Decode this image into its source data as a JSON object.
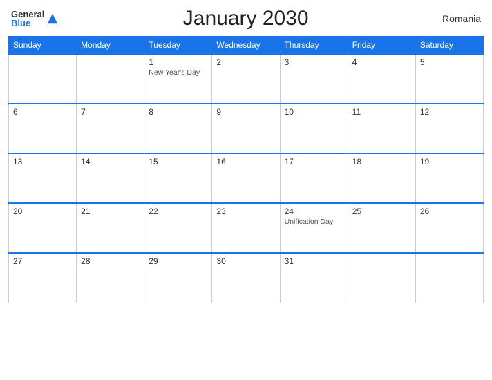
{
  "header": {
    "logo_general": "General",
    "logo_blue": "Blue",
    "title": "January 2030",
    "country": "Romania"
  },
  "days_of_week": [
    "Sunday",
    "Monday",
    "Tuesday",
    "Wednesday",
    "Thursday",
    "Friday",
    "Saturday"
  ],
  "weeks": [
    [
      {
        "day": "",
        "holiday": ""
      },
      {
        "day": "",
        "holiday": ""
      },
      {
        "day": "1",
        "holiday": "New Year's Day"
      },
      {
        "day": "2",
        "holiday": ""
      },
      {
        "day": "3",
        "holiday": ""
      },
      {
        "day": "4",
        "holiday": ""
      },
      {
        "day": "5",
        "holiday": ""
      }
    ],
    [
      {
        "day": "6",
        "holiday": ""
      },
      {
        "day": "7",
        "holiday": ""
      },
      {
        "day": "8",
        "holiday": ""
      },
      {
        "day": "9",
        "holiday": ""
      },
      {
        "day": "10",
        "holiday": ""
      },
      {
        "day": "11",
        "holiday": ""
      },
      {
        "day": "12",
        "holiday": ""
      }
    ],
    [
      {
        "day": "13",
        "holiday": ""
      },
      {
        "day": "14",
        "holiday": ""
      },
      {
        "day": "15",
        "holiday": ""
      },
      {
        "day": "16",
        "holiday": ""
      },
      {
        "day": "17",
        "holiday": ""
      },
      {
        "day": "18",
        "holiday": ""
      },
      {
        "day": "19",
        "holiday": ""
      }
    ],
    [
      {
        "day": "20",
        "holiday": ""
      },
      {
        "day": "21",
        "holiday": ""
      },
      {
        "day": "22",
        "holiday": ""
      },
      {
        "day": "23",
        "holiday": ""
      },
      {
        "day": "24",
        "holiday": "Unification Day"
      },
      {
        "day": "25",
        "holiday": ""
      },
      {
        "day": "26",
        "holiday": ""
      }
    ],
    [
      {
        "day": "27",
        "holiday": ""
      },
      {
        "day": "28",
        "holiday": ""
      },
      {
        "day": "29",
        "holiday": ""
      },
      {
        "day": "30",
        "holiday": ""
      },
      {
        "day": "31",
        "holiday": ""
      },
      {
        "day": "",
        "holiday": ""
      },
      {
        "day": "",
        "holiday": ""
      }
    ]
  ]
}
